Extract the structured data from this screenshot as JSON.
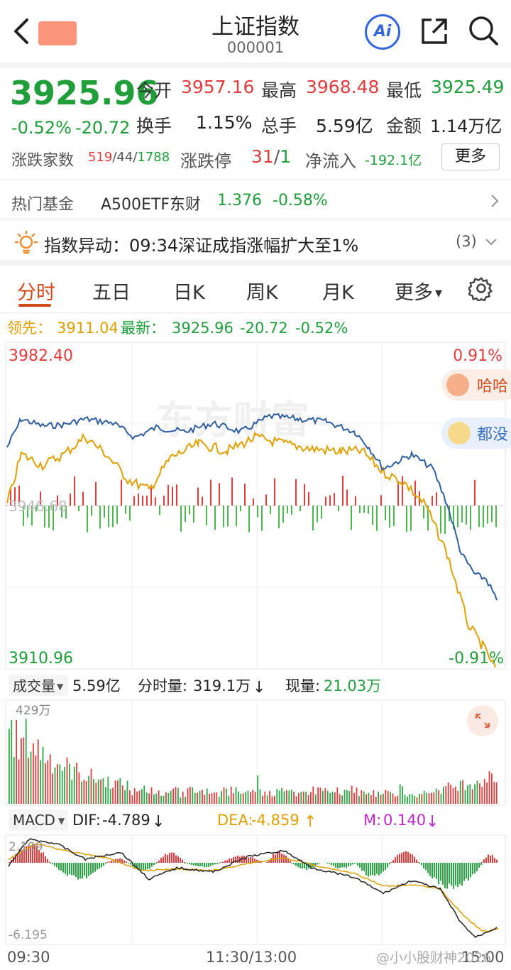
{
  "header": {
    "title": "上证指数",
    "code": "000001",
    "ai_label": "Ai"
  },
  "quote": {
    "price": "3925.96",
    "change_pct": "-0.52%",
    "change": "-20.72",
    "open_label": "今开",
    "open": "3957.16",
    "high_label": "最高",
    "high": "3968.48",
    "low_label": "最低",
    "low": "3925.49",
    "turnover_label": "换手",
    "turnover": "1.15%",
    "volume_label": "总手",
    "volume": "5.59亿",
    "amount_label": "金额",
    "amount": "1.14万亿",
    "updown_label": "涨跌家数",
    "up_count": "519",
    "flat_count": "/44/",
    "down_count": "1788",
    "limit_label": "涨跌停",
    "limit_up": "31",
    "limit_sep": "/",
    "limit_down": "1",
    "netflow_label": "净流入",
    "netflow": "-192.1亿",
    "more_label": "更多"
  },
  "hot_fund": {
    "label": "热门基金",
    "name": "A500ETF东财",
    "price": "1.376",
    "change": "-0.58%"
  },
  "alert": {
    "text": "指数异动：09:34深证成指涨幅扩大至1%",
    "count": "(3)"
  },
  "tabs": [
    "分时",
    "五日",
    "日K",
    "周K",
    "月K",
    "更多"
  ],
  "intraday": {
    "lead_label": "领先：",
    "lead_value": "3911.04",
    "latest_label": "最新：",
    "latest_value": "3925.96",
    "latest_change": "-20.72",
    "latest_pct": "-0.52%",
    "top_price": "3982.40",
    "top_pct": "0.91%",
    "bottom_price": "3910.96",
    "bottom_pct": "-0.91%",
    "mid_price": "3946.68",
    "bubble1": "哈哈",
    "bubble2": "都没",
    "watermark": "东方财富"
  },
  "volume_panel": {
    "selector": "成交量",
    "total": "5.59亿",
    "minute_label": "分时量:",
    "minute_value": "319.1万",
    "current_label": "现量:",
    "current_value": "21.03万",
    "max_label": "429万"
  },
  "macd_panel": {
    "selector": "MACD",
    "dif_label": "DIF:",
    "dif": "-4.789",
    "dea_label": "DEA:",
    "dea": "-4.859",
    "m_label": "M:",
    "m": "0.140",
    "top": "2.199",
    "bottom": "-6.195"
  },
  "time_axis": {
    "start": "09:30",
    "mid": "11:30/13:00",
    "end": "15:00"
  },
  "footer_watermark": "@小小股财神2026",
  "colors": {
    "up": "#e23c3c",
    "down": "#1f9e3a",
    "price_line": "#2f5fa0",
    "avg_line": "#e0a000",
    "accent": "#d04a1b"
  }
}
